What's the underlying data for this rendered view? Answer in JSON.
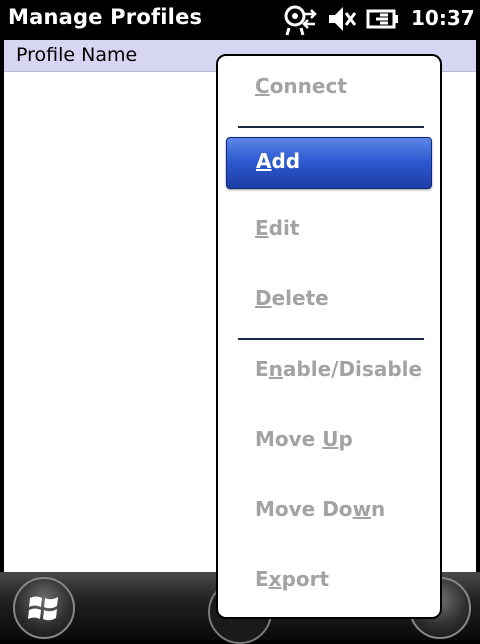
{
  "titlebar": {
    "title": "Manage Profiles",
    "clock": "10:37",
    "icons": [
      "connectivity-icon",
      "speaker-mute-icon",
      "battery-charging-icon"
    ]
  },
  "list": {
    "header": "Profile Name",
    "rows": []
  },
  "menu": {
    "items": [
      {
        "label": "Connect",
        "accel_index": 0,
        "enabled": false,
        "selected": false
      },
      {
        "label": "Add",
        "accel_index": 0,
        "enabled": true,
        "selected": true
      },
      {
        "label": "Edit",
        "accel_index": 0,
        "enabled": false,
        "selected": false
      },
      {
        "label": "Delete",
        "accel_index": 0,
        "enabled": false,
        "selected": false
      },
      {
        "label": "Enable/Disable",
        "accel_index": 1,
        "enabled": false,
        "selected": false
      },
      {
        "label": "Move Up",
        "accel_index": 5,
        "enabled": false,
        "selected": false
      },
      {
        "label": "Move Down",
        "accel_index": 7,
        "enabled": false,
        "selected": false
      },
      {
        "label": "Export",
        "accel_index": 1,
        "enabled": false,
        "selected": false
      }
    ]
  },
  "colors": {
    "selected_top": "#5c86e6",
    "selected_bottom": "#1d3ea6",
    "disabled_text": "#a3a3a3",
    "header_bg": "#d6d6f2"
  }
}
